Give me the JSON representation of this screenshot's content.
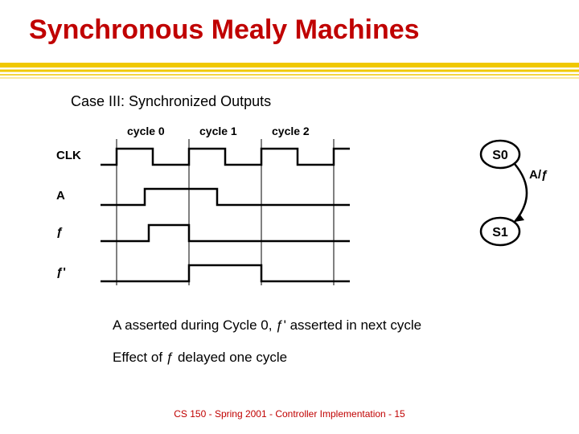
{
  "title": "Synchronous Mealy Machines",
  "subtitle": "Case III: Synchronized Outputs",
  "diagram": {
    "cycles": [
      "cycle 0",
      "cycle 1",
      "cycle 2"
    ],
    "signals": [
      "CLK",
      "A",
      "ƒ",
      "ƒ'"
    ]
  },
  "state": {
    "top": "S0",
    "bottom": "S1",
    "edge": "A/ƒ"
  },
  "body": {
    "line1": "A asserted during Cycle 0, ƒ' asserted in next cycle",
    "line2": "Effect of ƒ delayed one cycle"
  },
  "footer": "CS 150 - Spring 2001 - Controller Implementation - 15",
  "chart_data": {
    "type": "table",
    "title": "Timing diagram — synchronized Mealy outputs",
    "cycles": [
      "cycle 0",
      "cycle 1",
      "cycle 2"
    ],
    "signals": [
      {
        "name": "CLK",
        "pattern": "square wave, 3 full periods shown, low-then-high each cycle"
      },
      {
        "name": "A",
        "transitions": [
          {
            "cycle": 0,
            "position": "mid",
            "to": "high"
          },
          {
            "cycle": 1,
            "position": "mid",
            "to": "low"
          }
        ]
      },
      {
        "name": "ƒ",
        "transitions": [
          {
            "cycle": 0,
            "position": "mid",
            "to": "high"
          },
          {
            "cycle": 1,
            "position": "start",
            "to": "low"
          }
        ]
      },
      {
        "name": "ƒ'",
        "transitions": [
          {
            "cycle": 1,
            "position": "start",
            "to": "high"
          },
          {
            "cycle": 2,
            "position": "start",
            "to": "low"
          }
        ]
      }
    ],
    "state_machine": {
      "states": [
        "S0",
        "S1"
      ],
      "edges": [
        {
          "from": "S0",
          "to": "S1",
          "label": "A/ƒ"
        }
      ]
    }
  }
}
